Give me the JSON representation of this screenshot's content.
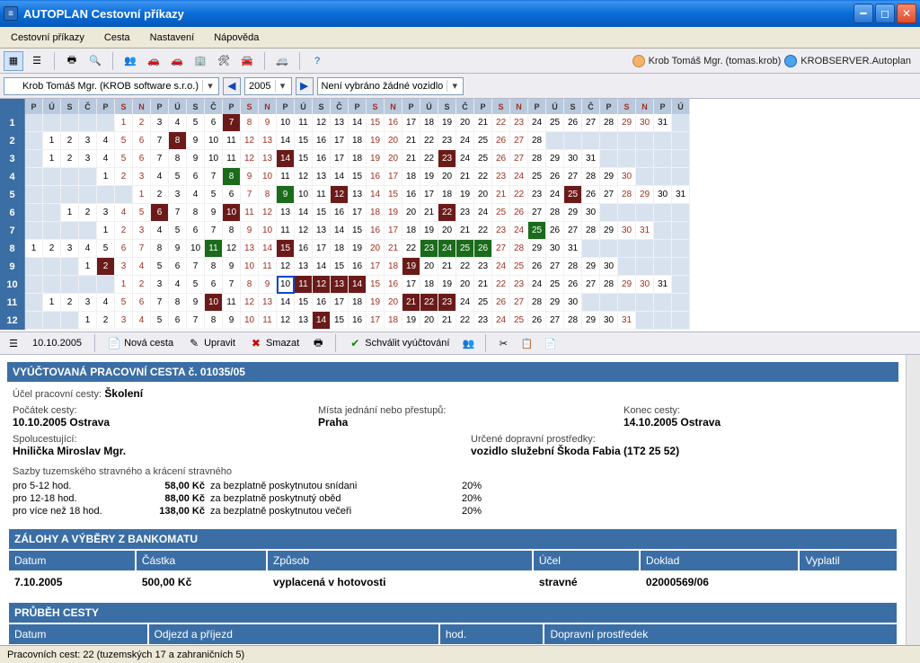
{
  "window": {
    "title": "AUTOPLAN Cestovní příkazy"
  },
  "menu": {
    "items": [
      "Cestovní příkazy",
      "Cesta",
      "Nastavení",
      "Nápověda"
    ]
  },
  "user": {
    "name": "Krob Tomáš Mgr. (tomas.krob)",
    "server": "KROBSERVER.Autoplan"
  },
  "sel": {
    "person": "Krob Tomáš Mgr. (KROB software s.r.o.)",
    "year": "2005",
    "vehicle": "Není vybráno žádné vozidlo"
  },
  "dayHeaders": [
    "P",
    "Ú",
    "S",
    "Č",
    "P",
    "S",
    "N"
  ],
  "calendar": {
    "months": [
      {
        "n": "1",
        "offset": 5,
        "days": 31,
        "hl": {
          "7": "r"
        }
      },
      {
        "n": "2",
        "offset": 1,
        "days": 28,
        "hl": {
          "8": "r"
        }
      },
      {
        "n": "3",
        "offset": 1,
        "days": 31,
        "hl": {
          "14": "r",
          "23": "r"
        }
      },
      {
        "n": "4",
        "offset": 4,
        "days": 30,
        "hl": {
          "8": "g"
        }
      },
      {
        "n": "5",
        "offset": 6,
        "days": 31,
        "hl": {
          "9": "g",
          "12": "r",
          "25": "r"
        }
      },
      {
        "n": "6",
        "offset": 2,
        "days": 30,
        "hl": {
          "6": "r",
          "10": "r",
          "22": "r"
        }
      },
      {
        "n": "7",
        "offset": 4,
        "days": 31,
        "hl": {
          "25": "g"
        }
      },
      {
        "n": "8",
        "offset": 0,
        "days": 31,
        "hl": {
          "11": "g",
          "15": "r",
          "23": "g",
          "24": "g",
          "25": "g",
          "26": "g"
        }
      },
      {
        "n": "9",
        "offset": 3,
        "days": 30,
        "hl": {
          "2": "r",
          "19": "r"
        }
      },
      {
        "n": "10",
        "offset": 5,
        "days": 31,
        "hl": {
          "10": "sel",
          "11": "r",
          "12": "r",
          "13": "r",
          "14": "r"
        }
      },
      {
        "n": "11",
        "offset": 1,
        "days": 30,
        "hl": {
          "10": "r",
          "21": "r",
          "22": "r",
          "23": "r"
        }
      },
      {
        "n": "12",
        "offset": 3,
        "days": 31,
        "hl": {
          "14": "r"
        }
      }
    ]
  },
  "tool3": {
    "date": "10.10.2005",
    "new": "Nová cesta",
    "edit": "Upravit",
    "delete": "Smazat",
    "approve": "Schválit vyúčtování"
  },
  "trip": {
    "header": "VYÚČTOVANÁ PRACOVNÍ CESTA č. 01035/05",
    "purpose_lbl": "Účel pracovní cesty:",
    "purpose": "Školení",
    "start_lbl": "Počátek cesty:",
    "start": "10.10.2005 Ostrava",
    "places_lbl": "Místa jednání nebo přestupů:",
    "places": "Praha",
    "end_lbl": "Konec cesty:",
    "end": "14.10.2005 Ostrava",
    "co_lbl": "Spolucestující:",
    "co": "Hnilička Miroslav Mgr.",
    "transport_lbl": "Určené dopravní prostředky:",
    "transport": "vozidlo služební Škoda Fabia (1T2 25 52)",
    "rates_hdr": "Sazby tuzemského stravného a krácení stravného",
    "rates": [
      {
        "span": "pro 5-12 hod.",
        "amt": "58,00 Kč",
        "note": "za bezplatně poskytnutou snídani",
        "pct": "20%"
      },
      {
        "span": "pro 12-18 hod.",
        "amt": "88,00 Kč",
        "note": "za bezplatně poskytnutý oběd",
        "pct": "20%"
      },
      {
        "span": "pro více než 18 hod.",
        "amt": "138,00 Kč",
        "note": "za bezplatně poskytnutou večeři",
        "pct": "20%"
      }
    ]
  },
  "advances": {
    "header": "ZÁLOHY A VÝBĚRY Z BANKOMATU",
    "cols": [
      "Datum",
      "Částka",
      "Způsob",
      "Účel",
      "Doklad",
      "Vyplatil"
    ],
    "rows": [
      {
        "date": "7.10.2005",
        "amt": "500,00  Kč",
        "method": "vyplacená v hotovosti",
        "purpose": "stravné",
        "doc": "02000569/06",
        "by": ""
      }
    ]
  },
  "itinerary": {
    "header": "PRŮBĚH CESTY",
    "cols": [
      "Datum",
      "Odjezd a příjezd",
      "hod.",
      "Dopravní prostředek"
    ]
  },
  "status": "Pracovních cest: 22 (tuzemských 17 a zahraničních 5)"
}
